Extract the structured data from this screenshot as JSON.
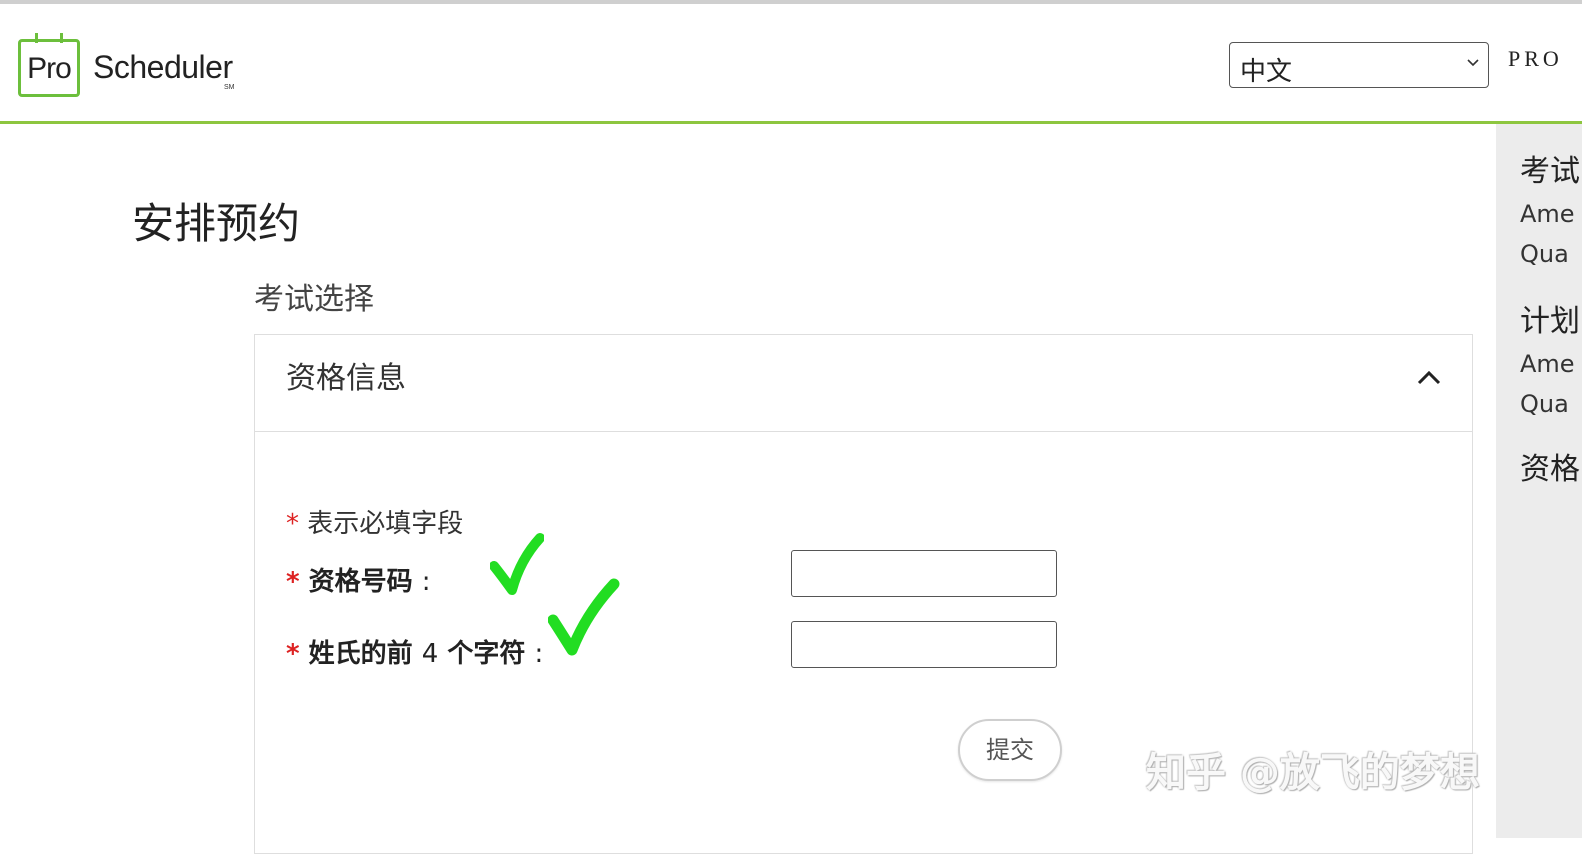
{
  "header": {
    "logo_box_text": "Pro",
    "logo_wordmark": "Scheduler",
    "logo_sm": "SM",
    "language": {
      "selected": "中文",
      "icon": "chevron-down-icon"
    },
    "right_cut_text": "PRO"
  },
  "sidebar": {
    "lines": [
      {
        "text": "考试",
        "kind": "head"
      },
      {
        "text": "Ame",
        "kind": "line"
      },
      {
        "text": "Qua",
        "kind": "line"
      },
      {
        "text": "计划",
        "kind": "head"
      },
      {
        "text": "Ame",
        "kind": "line"
      },
      {
        "text": "Qua",
        "kind": "line"
      },
      {
        "text": "资格",
        "kind": "head"
      }
    ]
  },
  "main": {
    "page_title": "安排预约",
    "section_title": "考试选择",
    "panel": {
      "title": "资格信息",
      "toggle_icon": "chevron-up-icon",
      "required_marker": "*",
      "required_note": "表示必填字段",
      "fields": [
        {
          "label": "资格号码",
          "colon": ":",
          "value": ""
        },
        {
          "label_part1": "姓氏的前",
          "label_num": "4",
          "label_part2": "个字符",
          "colon": ":",
          "value": ""
        }
      ],
      "submit_label": "提交"
    }
  },
  "annotations": {
    "checkmark_color": "#22dd22"
  },
  "watermark": "知乎 @放飞的梦想",
  "colors": {
    "accent_green": "#8dc63f",
    "logo_green": "#6cbf3c",
    "required_red": "#dd2222"
  }
}
